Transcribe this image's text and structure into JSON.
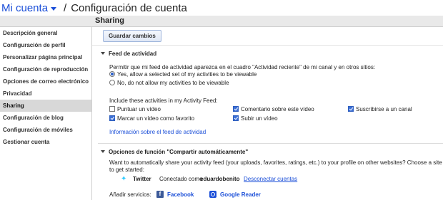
{
  "topbar": {
    "account": "Mi cuenta",
    "separator": "/",
    "title": "Configuración de cuenta"
  },
  "section": {
    "title": "Sharing"
  },
  "sidebar": {
    "items": [
      {
        "label": "Descripción general"
      },
      {
        "label": "Configuración de perfil"
      },
      {
        "label": "Personalizar página principal"
      },
      {
        "label": "Configuración de reproducción"
      },
      {
        "label": "Opciones de correo electrónico"
      },
      {
        "label": "Privacidad"
      },
      {
        "label": "Sharing",
        "active": true
      },
      {
        "label": "Configuración de blog"
      },
      {
        "label": "Configuración de móviles"
      },
      {
        "label": "Gestionar cuenta"
      }
    ]
  },
  "toolbar": {
    "save_label": "Guardar cambios"
  },
  "activity": {
    "heading": "Feed de actividad",
    "question": "Permitir que mi feed de actividad aparezca en el cuadro \"Actividad reciente\" de mi canal y en otros sitios:",
    "radio_yes": "Yes, allow a selected set of my activities to be viewable",
    "radio_no": "No, do not allow my activities to be viewable",
    "include_label": "Include these activities in my Activity Feed:",
    "options": {
      "rate": "Puntuar un vídeo",
      "favorite": "Marcar un vídeo como favorito",
      "comment": "Comentario sobre este vídeo",
      "upload": "Subir un vídeo",
      "subscribe": "Suscribirse a un canal"
    },
    "info_link": "Información sobre el feed de actividad"
  },
  "autoshare": {
    "heading": "Opciones de función \"Compartir automáticamente\"",
    "desc_line1": "Want to automatically share your activity feed (your uploads, favorites, ratings, etc.) to your profile on other websites? Choose a site",
    "desc_line2": "to get started:",
    "twitter": {
      "name": "Twitter",
      "connected_prefix": "Conectado como",
      "user": "eduardobenito",
      "disconnect": "Desconectar cuentas"
    },
    "add_services_label": "Añadir servicios:",
    "facebook": "Facebook",
    "google_reader": "Google Reader"
  },
  "colors": {
    "link": "#1a4ed8",
    "twitter": "#33ccff",
    "facebook": "#3b5998"
  }
}
